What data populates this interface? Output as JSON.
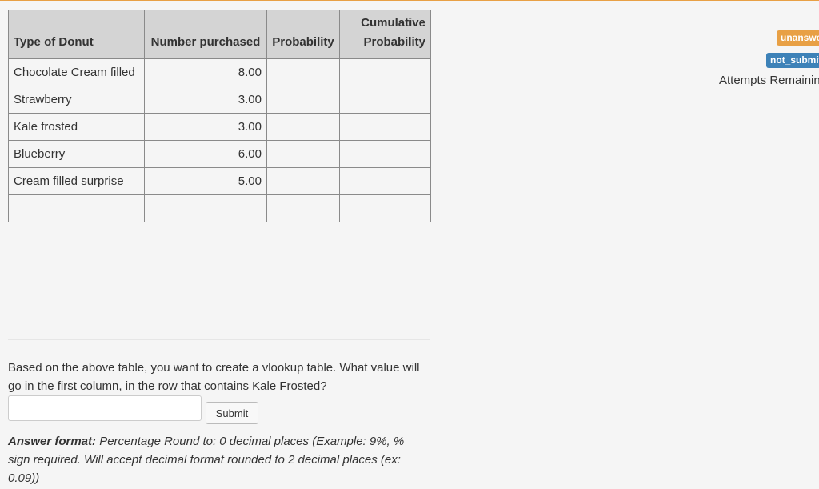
{
  "table": {
    "headers": {
      "type": "Type of Donut",
      "number": "Number purchased",
      "probability": "Probability",
      "cumulative_line1": "Cumulative",
      "cumulative_line2": "Probability"
    },
    "rows": [
      {
        "type": "Chocolate Cream filled",
        "number": "8.00",
        "probability": "",
        "cumulative": ""
      },
      {
        "type": "Strawberry",
        "number": "3.00",
        "probability": "",
        "cumulative": ""
      },
      {
        "type": "Kale frosted",
        "number": "3.00",
        "probability": "",
        "cumulative": ""
      },
      {
        "type": "Blueberry",
        "number": "6.00",
        "probability": "",
        "cumulative": ""
      },
      {
        "type": "Cream filled surprise",
        "number": "5.00",
        "probability": "",
        "cumulative": ""
      },
      {
        "type": "",
        "number": "",
        "probability": "",
        "cumulative": ""
      }
    ]
  },
  "question": {
    "text": "Based on the above table, you want to create a vlookup table. What value will go in the first column, in the row that contains Kale Frosted?",
    "input_value": "",
    "submit_label": "Submit",
    "format_label": "Answer format:",
    "format_text": " Percentage Round to: 0 decimal places (Example: 9%, % sign required. Will accept decimal format rounded to 2 decimal places (ex: 0.09))"
  },
  "status": {
    "unanswered": "unanswered",
    "not_submitted": "not_submitted",
    "attempts": "Attempts Remaining"
  },
  "colors": {
    "unanswered_badge": "#e8a045",
    "not_submitted_badge": "#3d82b8",
    "header_bg": "#d4d4d4",
    "page_bg": "#f5f5f5"
  }
}
